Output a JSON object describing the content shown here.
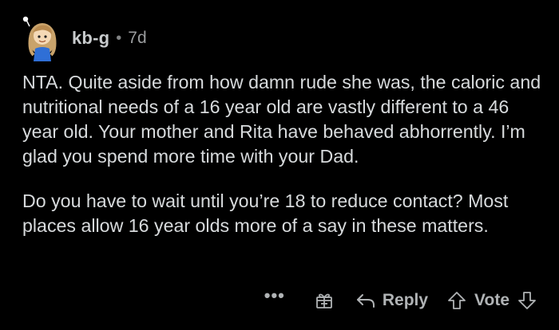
{
  "comment": {
    "author": "kb-g",
    "separator": "•",
    "age": "7d",
    "avatar_icon": "snoo-avatar-icon",
    "paragraphs": [
      "NTA. Quite aside from how damn rude she was, the caloric and nutritional needs of a 16 year old are vastly different to a 46 year old. Your mother and Rita have behaved abhorrently. I’m glad you spend more time with your Dad.",
      "Do you have to wait until you’re 18 to reduce contact? Most places allow 16 year olds more of a say in these matters."
    ]
  },
  "actions": {
    "more_label": "•••",
    "gift_icon": "gift-icon",
    "reply_label": "Reply",
    "reply_icon": "reply-arrow-icon",
    "vote_label": "Vote",
    "upvote_icon": "upvote-arrow-icon",
    "downvote_icon": "downvote-arrow-icon"
  },
  "colors": {
    "background": "#000000",
    "text": "#d7dadc",
    "meta": "#9a9c9e",
    "action": "#b0b3b5"
  }
}
